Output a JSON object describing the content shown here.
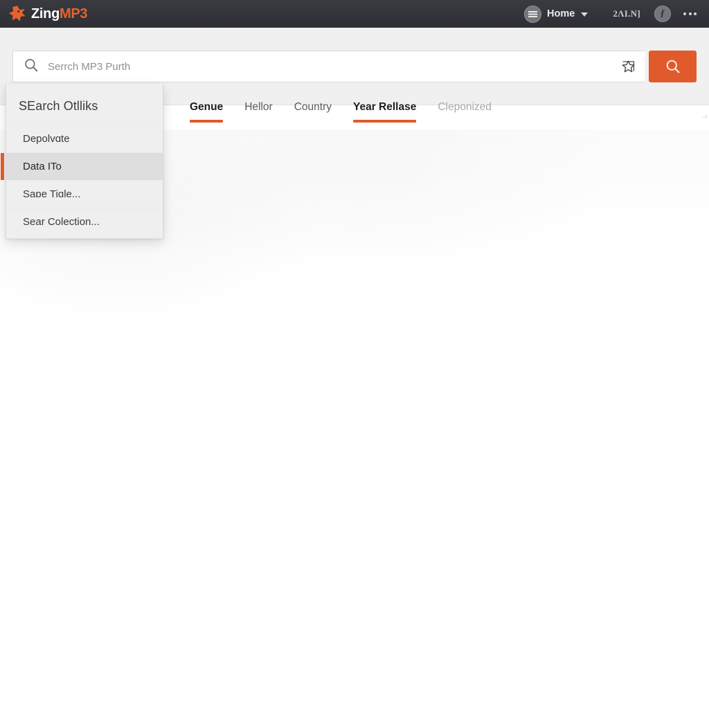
{
  "header": {
    "brand": {
      "part1": "Zing",
      "part2": "MP3",
      "icon": "star-icon"
    },
    "home": {
      "label": "Home",
      "icon": "hamburger-circle-icon",
      "chevron": "chevron-down-icon"
    },
    "garbled_label": "2ΛΙ.N]",
    "info": {
      "icon": "info-circle-icon",
      "glyph": "ƒ"
    },
    "overflow": {
      "icon": "more-options-icon"
    },
    "bg_color": "#35363b",
    "accent_color": "#e8632c"
  },
  "search": {
    "value": "",
    "placeholder": "Serrch MP3 Purth",
    "magnifier_icon": "search-icon",
    "bookmark_icon": "star-bookmark-icon",
    "submit_icon": "search-icon",
    "submit_color": "#e05a2b"
  },
  "tabs": [
    {
      "label": "Genue",
      "active": true,
      "muted": false
    },
    {
      "label": "Hellor",
      "active": false,
      "muted": false
    },
    {
      "label": "Country",
      "active": false,
      "muted": false
    },
    {
      "label": "Year Rellase",
      "active": true,
      "muted": false
    },
    {
      "label": "Cleponized",
      "active": false,
      "muted": true
    }
  ],
  "tab_edge_ghost": "․ₑ",
  "dropdown": {
    "title": "SEarch Otlliks",
    "items": [
      {
        "label": "Depolvɑte",
        "selected": false
      },
      {
        "label": "Data ITo",
        "selected": true
      },
      {
        "label": "Saɒe Tiɑle...",
        "selected": false
      },
      {
        "label": "Sear Colection...",
        "selected": false
      }
    ],
    "accent_color": "#e05a2b",
    "selected_bg": "#dedede"
  },
  "main": {
    "content": ""
  }
}
